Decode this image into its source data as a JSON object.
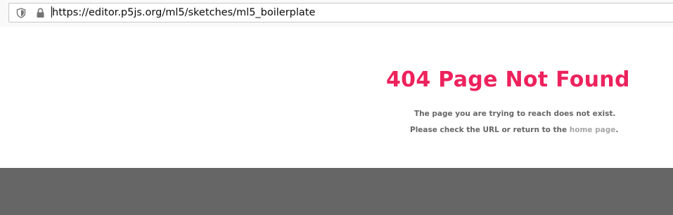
{
  "browser": {
    "url": "https://editor.p5js.org/ml5/sketches/ml5_boilerplate",
    "icons": [
      "shield-icon",
      "lock-icon"
    ]
  },
  "error": {
    "title": "404 Page Not Found",
    "message_line1": "The page you are trying to reach does not exist.",
    "message_line2_prefix": "Please check the URL or return to the ",
    "home_link": "home page",
    "message_line2_suffix": "."
  },
  "colors": {
    "title": "#ed225d",
    "message": "#666666",
    "link": "#a6a6a6",
    "footer": "#666666"
  }
}
